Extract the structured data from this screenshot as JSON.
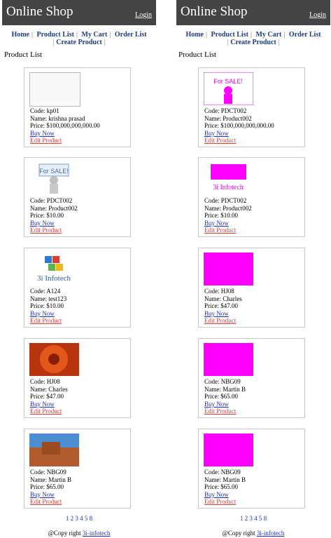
{
  "panels": [
    {
      "header": {
        "title": "Online Shop",
        "login": "Login"
      },
      "nav": [
        "Home",
        "Product List",
        "My Cart",
        "Order List",
        "Create Product"
      ],
      "section_title": "Product List",
      "cards": [
        {
          "code": "Code: kp01",
          "name": "Name: krishna prasad",
          "price": "Price: $100,000,000,000.00",
          "buy": "Buy Now",
          "edit": "Edit Product"
        },
        {
          "code": "Code: PDCT002",
          "name": "Name: Product002",
          "price": "Price: $10.00",
          "buy": "Buy Now",
          "edit": "Edit Product"
        },
        {
          "code": "Code: A124",
          "name": "Name: test123",
          "price": "Price: $10.00",
          "buy": "Buy Now",
          "edit": "Edit Product"
        },
        {
          "code": "Code: HJ08",
          "name": "Name: Charles",
          "price": "Price: $47.00",
          "buy": "Buy Now",
          "edit": "Edit Product"
        },
        {
          "code": "Code: NBG09",
          "name": "Name: Martin B",
          "price": "Price: $65.00",
          "buy": "Buy Now",
          "edit": "Edit Product"
        }
      ],
      "pager": "1 2 3 4 5 8",
      "footer": {
        "text": "@Copy right",
        "link": "3i-infotech"
      }
    },
    {
      "header": {
        "title": "Online Shop",
        "login": "Login"
      },
      "nav": [
        "Home",
        "Product List",
        "My Cart",
        "Order List",
        "Create Product"
      ],
      "section_title": "Product List",
      "cards": [
        {
          "code": "Code: PDCT002",
          "name": "Name: Product002",
          "price": "Price: $100,000,000,000.00",
          "buy": "Buy Now",
          "edit": "Edit Product"
        },
        {
          "code": "Code: PDCT002",
          "name": "Name: Product002",
          "price": "Price: $10.00",
          "buy": "Buy Now",
          "edit": "Edit Product"
        },
        {
          "code": "Code: HJ08",
          "name": "Name: Charles",
          "price": "Price: $47.00",
          "buy": "Buy Now",
          "edit": "Edit Product"
        },
        {
          "code": "Code: NBG09",
          "name": "Name: Martin B",
          "price": "Price: $65.00",
          "buy": "Buy Now",
          "edit": "Edit Product"
        },
        {
          "code": "Code: NBG09",
          "name": "Name: Martin B",
          "price": "Price: $65.00",
          "buy": "Buy Now",
          "edit": "Edit Product"
        }
      ],
      "pager": "1 2 3 4 5 8",
      "footer": {
        "text": "@Copy right",
        "link": "3i-infotech"
      }
    }
  ],
  "colors": {
    "header": "#444444",
    "nav": "#1c3d8b",
    "link": "#1d2fd2",
    "edit": "#e03a3a",
    "magenta": "#ff00ff"
  }
}
